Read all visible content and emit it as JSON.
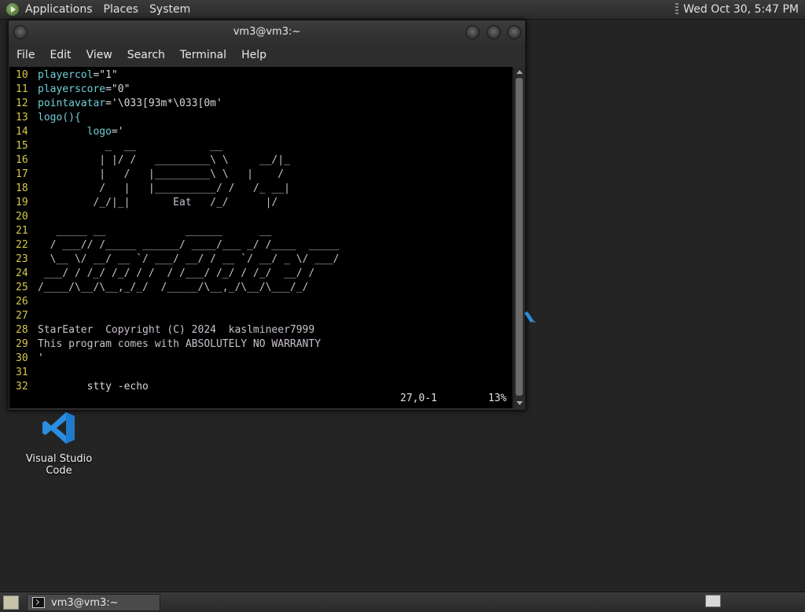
{
  "top_panel": {
    "menus": [
      "Applications",
      "Places",
      "System"
    ],
    "clock": "Wed Oct 30,  5:47 PM"
  },
  "window": {
    "title": "vm3@vm3:~",
    "menus": [
      "File",
      "Edit",
      "View",
      "Search",
      "Terminal",
      "Help"
    ]
  },
  "editor": {
    "lines": [
      {
        "n": "10",
        "kw": "playercol",
        "eq": "=",
        "rest": "\"1\"",
        "style": "plain"
      },
      {
        "n": "11",
        "kw": "playerscore",
        "eq": "=",
        "rest": "\"0\"",
        "style": "plain"
      },
      {
        "n": "12",
        "kw": "pointavatar",
        "eq": "=",
        "rest": "'\\033[93m*\\033[0m'",
        "style": "plain"
      },
      {
        "n": "13",
        "kw": "logo(){",
        "eq": "",
        "rest": "",
        "style": "plain"
      },
      {
        "n": "14",
        "kw": "        logo",
        "eq": "=",
        "rest": "'",
        "style": "plain"
      },
      {
        "n": "15",
        "kw": "",
        "eq": "",
        "rest": "           _  __            __",
        "style": "str"
      },
      {
        "n": "16",
        "kw": "",
        "eq": "",
        "rest": "          | |/ /   _________\\ \\     __/|_",
        "style": "str"
      },
      {
        "n": "17",
        "kw": "",
        "eq": "",
        "rest": "          |   /   |_________\\ \\   |    /",
        "style": "str"
      },
      {
        "n": "18",
        "kw": "",
        "eq": "",
        "rest": "          /   |   |__________/ /   /_ __|",
        "style": "str"
      },
      {
        "n": "19",
        "kw": "",
        "eq": "",
        "rest": "         /_/|_|       Eat   /_/      |/",
        "style": "str"
      },
      {
        "n": "20",
        "kw": "",
        "eq": "",
        "rest": "",
        "style": "str"
      },
      {
        "n": "21",
        "kw": "",
        "eq": "",
        "rest": "   _____ __             ______      __",
        "style": "str"
      },
      {
        "n": "22",
        "kw": "",
        "eq": "",
        "rest": "  / ___// /_____ ______/ ____/___ _/ /____  _____",
        "style": "str"
      },
      {
        "n": "23",
        "kw": "",
        "eq": "",
        "rest": "  \\__ \\/ __/ __ `/ ___/ __/ / __ `/ __/ _ \\/ ___/",
        "style": "str"
      },
      {
        "n": "24",
        "kw": "",
        "eq": "",
        "rest": " ___/ / /_/ /_/ / /  / /___/ /_/ / /_/  __/ /",
        "style": "str"
      },
      {
        "n": "25",
        "kw": "",
        "eq": "",
        "rest": "/____/\\__/\\__,_/_/  /_____/\\__,_/\\__/\\___/_/",
        "style": "str"
      },
      {
        "n": "26",
        "kw": "",
        "eq": "",
        "rest": "",
        "style": "str"
      },
      {
        "n": "27",
        "kw": "",
        "eq": "",
        "rest": "",
        "style": "str"
      },
      {
        "n": "28",
        "kw": "",
        "eq": "",
        "rest": "StarEater  Copyright (C) 2024  kaslmineer7999",
        "style": "str"
      },
      {
        "n": "29",
        "kw": "",
        "eq": "",
        "rest": "This program comes with ABSOLUTELY NO WARRANTY",
        "style": "str"
      },
      {
        "n": "30",
        "kw": "",
        "eq": "",
        "rest": "'",
        "style": "strs"
      },
      {
        "n": "31",
        "kw": "",
        "eq": "",
        "rest": "",
        "style": "plain"
      },
      {
        "n": "32",
        "kw": "",
        "eq": "",
        "rest": "        stty -echo",
        "style": "plain"
      }
    ],
    "status_position": "27,0-1",
    "status_percent": "13%"
  },
  "desktop": {
    "icon_label": "Visual Studio Code",
    "icon_color": "#2a8ee0"
  },
  "taskbar": {
    "task_label": "vm3@vm3:~"
  }
}
